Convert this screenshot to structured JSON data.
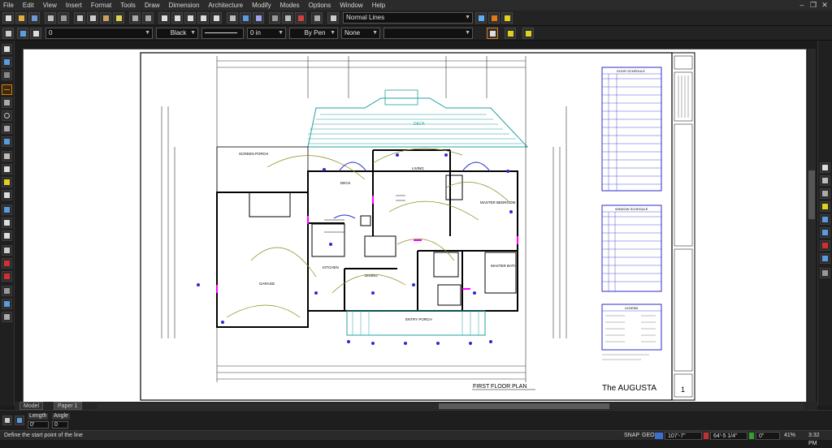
{
  "menu": [
    "File",
    "Edit",
    "View",
    "Insert",
    "Format",
    "Tools",
    "Draw",
    "Dimension",
    "Architecture",
    "Modify",
    "Modes",
    "Options",
    "Window",
    "Help"
  ],
  "toolbar": {
    "line_style_combo": "Normal Lines",
    "layer_combo": "0",
    "color_combo": "Black",
    "thickness_combo": "0 in",
    "pen_combo": "By Pen",
    "fill_combo": "None"
  },
  "tabs": {
    "model": "Model",
    "paper": "Paper 1"
  },
  "inputs": {
    "length_label": "Length",
    "angle_label": "Angle",
    "length_value": "0'",
    "angle_value": "0"
  },
  "status": {
    "prompt": "Define the start point of the line",
    "snap": "SNAP",
    "geo": "GEO",
    "x_coord": "107'-7\"",
    "y_coord": "64'-5 1/4\"",
    "z_coord": "0\"",
    "zoom": "41%",
    "time": "3:32 PM"
  },
  "drawing": {
    "plan_title": "FIRST FLOOR PLAN",
    "project_title": "The AUGUSTA",
    "sheet_number": "1",
    "door_schedule_title": "DOOR SCHEDULE",
    "window_schedule_title": "WINDOW SCHEDULE",
    "legend_title": "LEGEND",
    "rooms": {
      "deck": "DECK",
      "living": "LIVING",
      "master_bedroom": "MASTER BEDROOM",
      "master_bath": "MASTER BATH",
      "dining": "DINING",
      "kitchen": "KITCHEN",
      "garage": "GARAGE",
      "entry_porch": "ENTRY PORCH",
      "screen_porch": "SCREEN PORCH",
      "deck_left": "DECK"
    }
  },
  "colors": {
    "wall": "#000000",
    "deck_hatch": "#21a0a0",
    "electrical": "#8a8a1e",
    "dimension": "#333333",
    "table_border": "#2a2ad0",
    "highlight": "#ff00ff",
    "selected_tool": "#e07a12"
  }
}
